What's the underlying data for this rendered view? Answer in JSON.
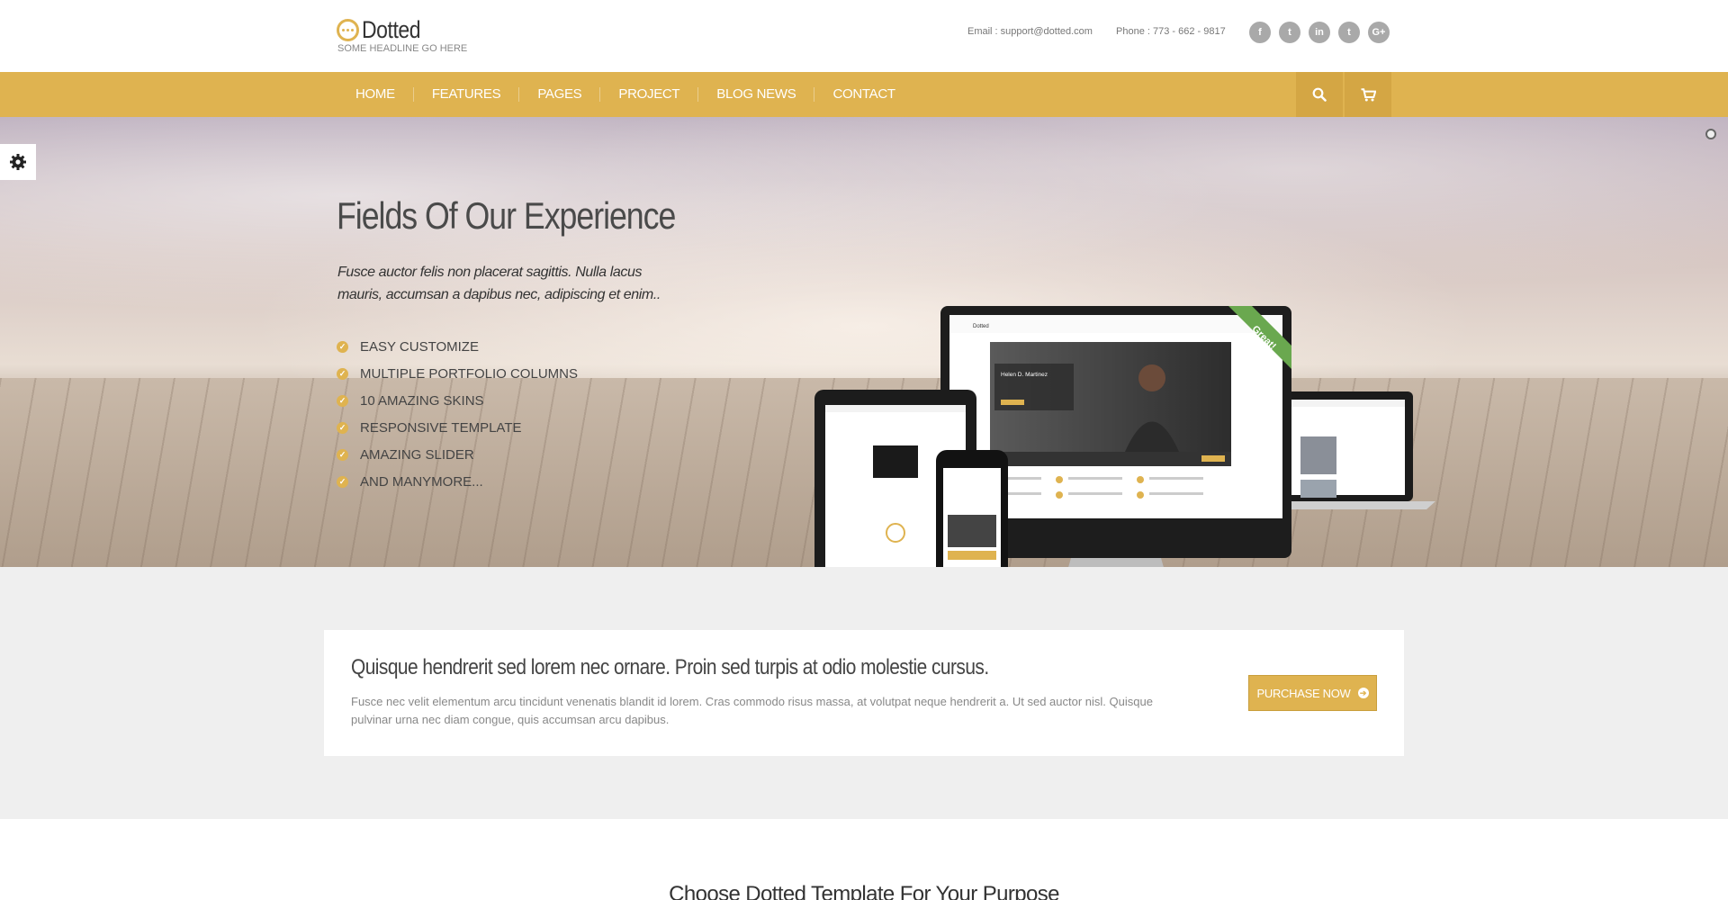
{
  "header": {
    "logo": "Dotted",
    "tagline": "SOME HEADLINE GO HERE",
    "email": "Email : support@dotted.com",
    "phone": "Phone : 773 - 662 - 9817",
    "socials": [
      {
        "icon": "facebook-icon",
        "glyph": "f"
      },
      {
        "icon": "twitter-icon",
        "glyph": "t"
      },
      {
        "icon": "linkedin-icon",
        "glyph": "in"
      },
      {
        "icon": "tumblr-icon",
        "glyph": "t"
      },
      {
        "icon": "google-plus-icon",
        "glyph": "G+"
      }
    ]
  },
  "nav": {
    "items": [
      "HOME",
      "FEATURES",
      "PAGES",
      "PROJECT",
      "BLOG NEWS",
      "CONTACT"
    ],
    "search_icon": "search-icon",
    "cart_icon": "cart-icon"
  },
  "hero": {
    "title": "Fields Of Our Experience",
    "subtitle": "Fusce auctor felis non placerat sagittis. Nulla lacus mauris, accumsan a dapibus nec, adipiscing et enim..",
    "features": [
      "EASY CUSTOMIZE",
      "MULTIPLE PORTFOLIO COLUMNS",
      "10 AMAZING SKINS",
      "RESPONSIVE TEMPLATE",
      "AMAZING SLIDER",
      "AND MANYMORE..."
    ],
    "device_ribbon": "Great!",
    "mock_logo": "Dotted",
    "mock_person": "Helen D. Martinez"
  },
  "cta": {
    "title": "Quisque hendrerit sed lorem nec ornare. Proin sed turpis at odio molestie cursus.",
    "text": "Fusce nec velit elementum arcu tincidunt venenatis blandit id lorem. Cras commodo risus massa, at volutpat neque hendrerit a. Ut sed auctor nisl. Quisque pulvinar urna nec diam congue, quis accumsan arcu dapibus.",
    "button": "PURCHASE NOW"
  },
  "section": {
    "title": "Choose Dotted Template For Your Purpose"
  },
  "colors": {
    "accent": "#dfb350",
    "accent_dark": "#d4a644"
  }
}
